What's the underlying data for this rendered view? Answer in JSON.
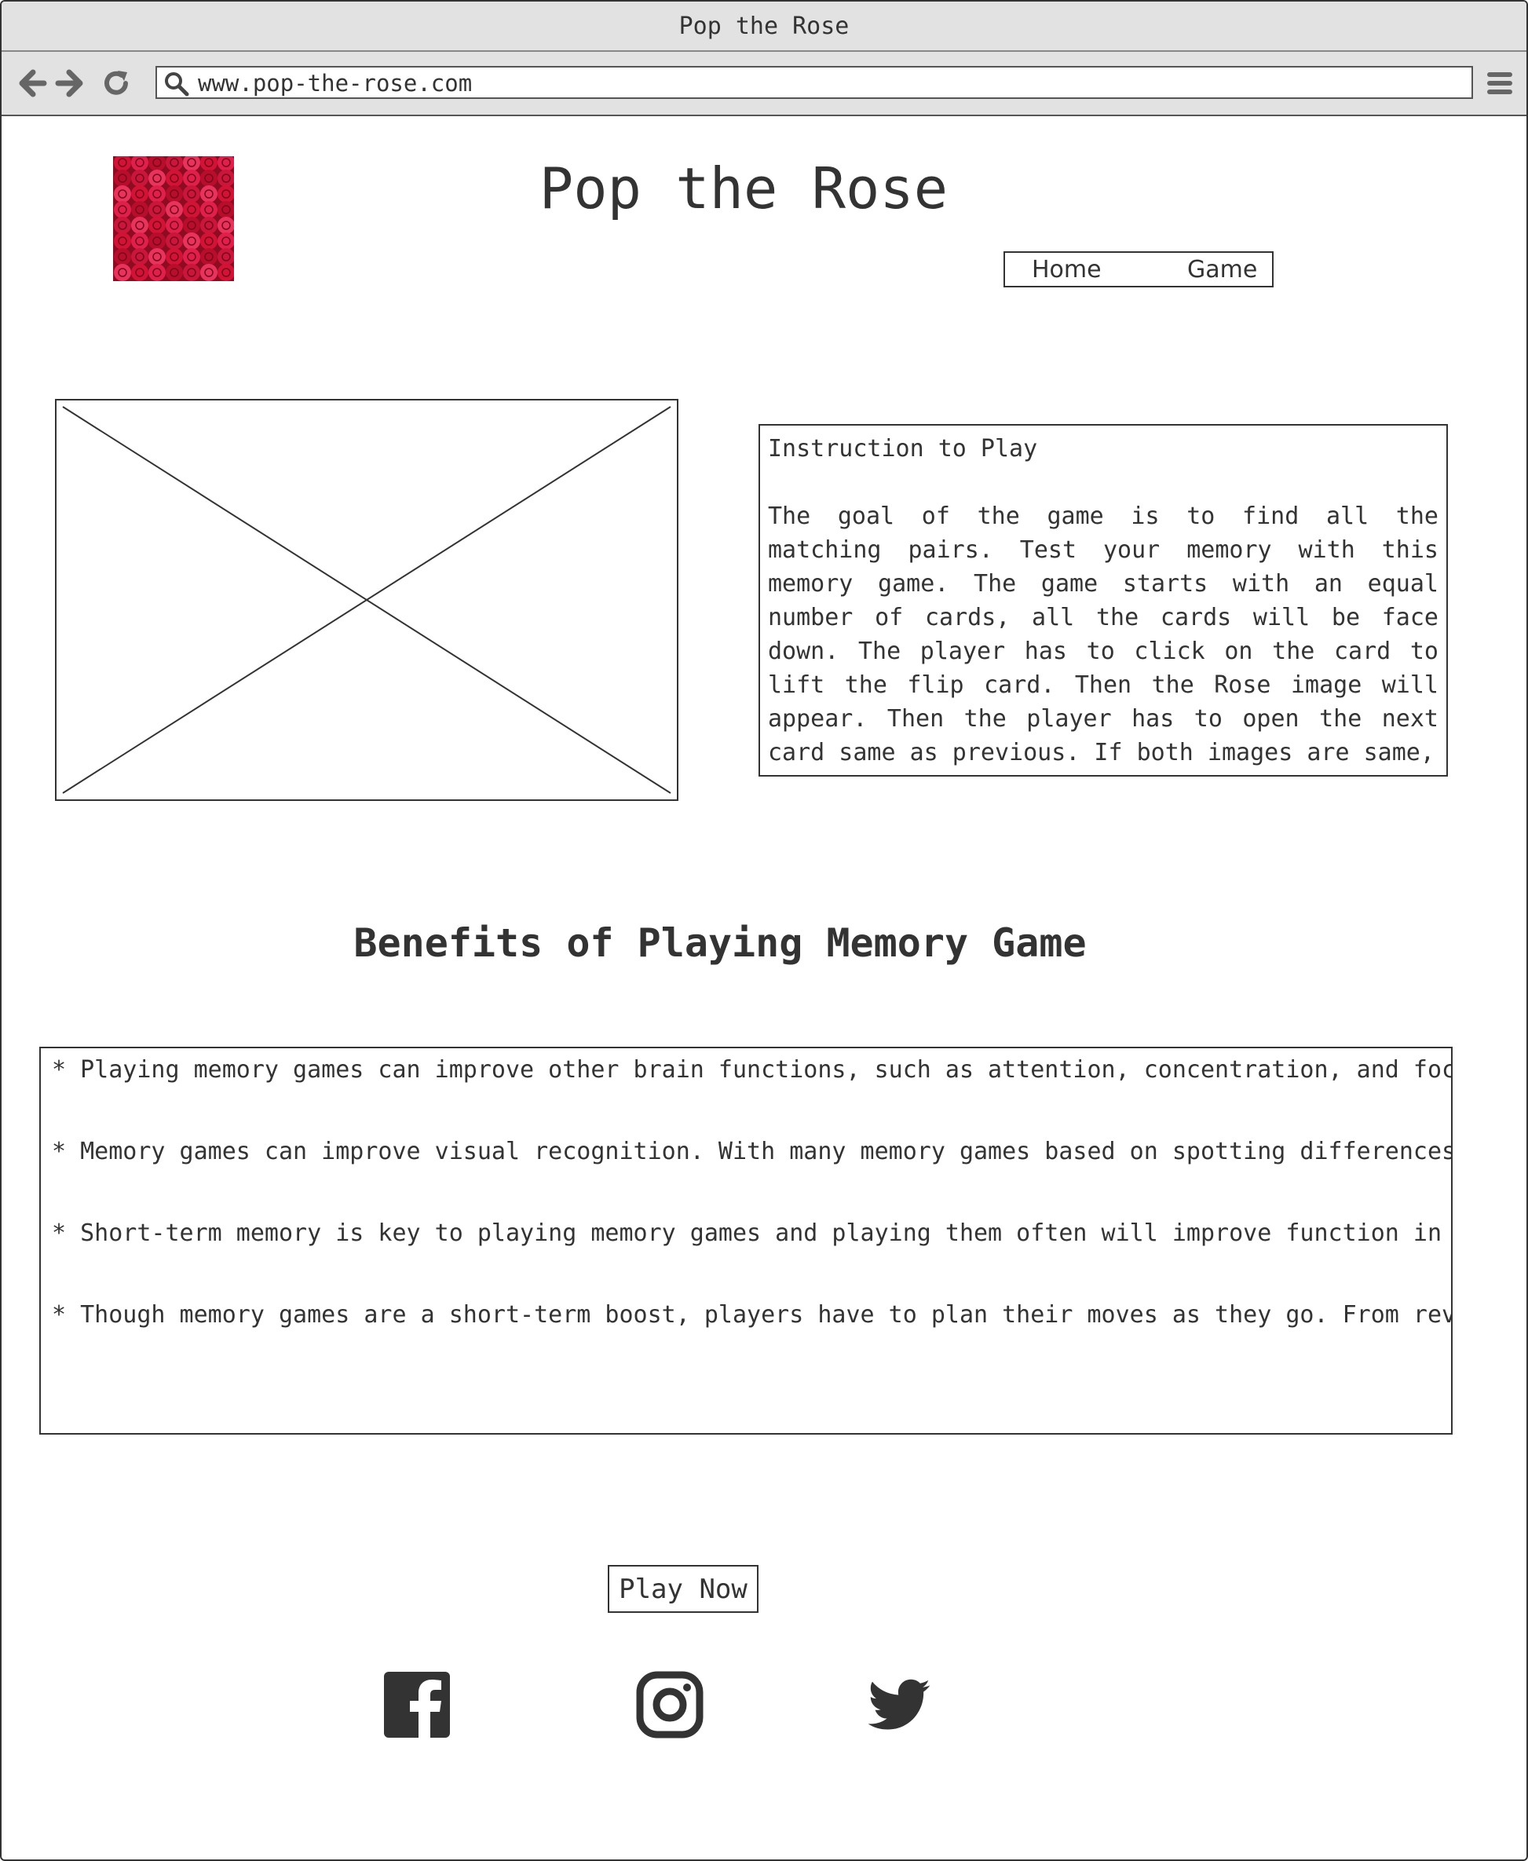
{
  "window": {
    "title": "Pop the Rose"
  },
  "browser": {
    "url": "www.pop-the-rose.com",
    "icons": [
      "back-arrow-icon",
      "forward-arrow-icon",
      "reload-icon",
      "search-icon",
      "hamburger-menu-icon"
    ]
  },
  "header": {
    "logo_icon": "rose-photo",
    "title": "Pop the Rose",
    "nav": {
      "home": "Home",
      "game": "Game"
    }
  },
  "instructions": {
    "heading": "Instruction to Play",
    "body": "The goal of the game is to find all the matching pairs. Test your memory with this memory game. The game starts with an equal number of cards, all the cards will be face down. The player has to click on the card to lift the flip card. Then the Rose image will appear. Then the player has to open the next card same as previous. If both images are same,"
  },
  "benefits": {
    "title": "Benefits of Playing Memory Game",
    "items": [
      "* Playing memory games can improve other brain functions, such as attention, concentration, and foc",
      "* Memory games can improve visual recognition. With many memory games based on spotting differences",
      "* Short-term memory is key to playing memory games and playing them often will improve function in",
      "* Though memory games are a short-term boost, players have to plan their moves as they go. From rev"
    ]
  },
  "cta": {
    "play_label": "Play Now"
  },
  "social": {
    "icons": [
      "facebook-icon",
      "instagram-icon",
      "twitter-icon"
    ]
  },
  "colors": {
    "ink": "#333333",
    "chrome": "#e2e2e2",
    "rose": "#c8102e"
  }
}
